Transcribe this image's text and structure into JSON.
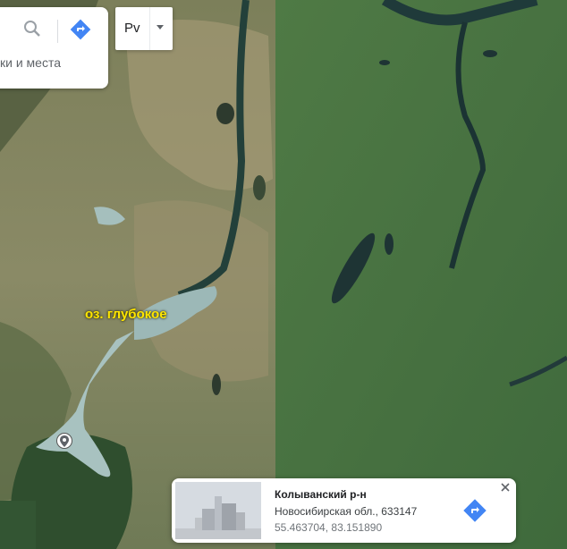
{
  "search": {
    "hint": "ки и места",
    "search_icon": "search-icon",
    "directions_icon": "directions-icon"
  },
  "language": {
    "label": "Рv",
    "dropdown_icon": "caret-down-icon"
  },
  "map": {
    "label": "оз. глубокое",
    "label_color": "#ffe600",
    "pin_icon": "place-pin-icon"
  },
  "card": {
    "name": "Колыванский р-н",
    "address": "Новосибирская обл., 633147",
    "coordinates": "55.463704, 83.151890",
    "route_icon": "directions-icon",
    "close_icon": "close-icon",
    "accent": "#4285f4"
  }
}
